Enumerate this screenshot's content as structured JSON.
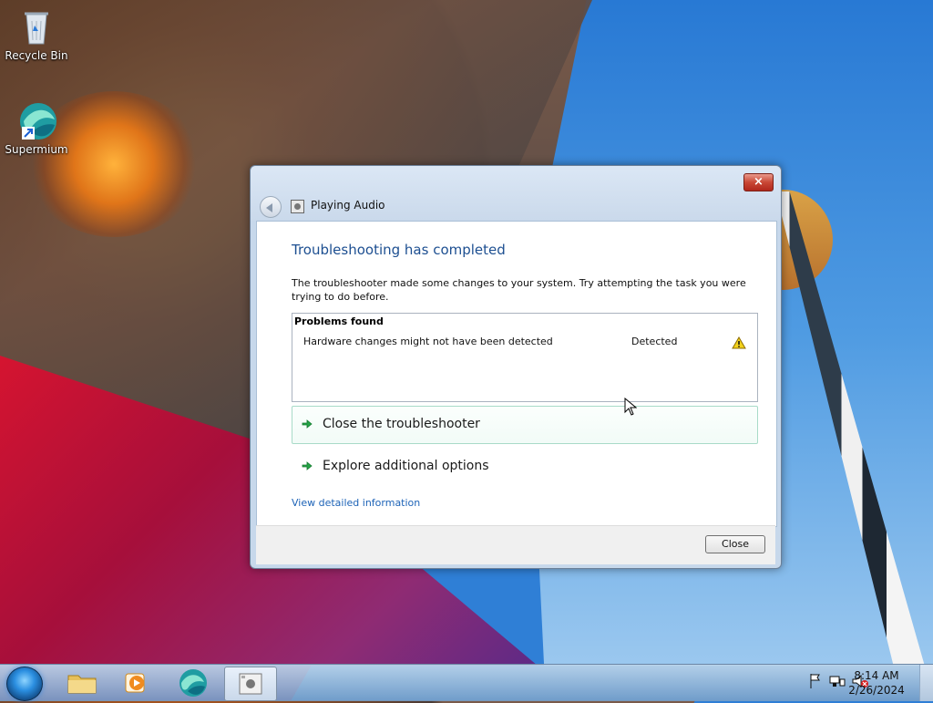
{
  "desktop": {
    "icons": [
      {
        "label": "Recycle Bin",
        "icon": "recycle-bin-icon"
      },
      {
        "label": "Supermium",
        "icon": "supermium-icon"
      }
    ]
  },
  "dialog": {
    "title": "Playing Audio",
    "headline": "Troubleshooting has completed",
    "description": "The troubleshooter made some changes to your system. Try attempting the task you were trying to do before.",
    "problems_header": "Problems found",
    "problems": [
      {
        "text": "Hardware changes might not have been detected",
        "status": "Detected",
        "icon": "warning-icon"
      }
    ],
    "actions": [
      {
        "label": "Close the troubleshooter",
        "icon": "green-arrow-icon"
      },
      {
        "label": "Explore additional options",
        "icon": "green-arrow-icon"
      }
    ],
    "detail_link": "View detailed information",
    "close_button": "Close",
    "close_icon": "close-icon"
  },
  "taskbar": {
    "items": [
      "start-orb-icon",
      "file-explorer-icon",
      "media-player-icon",
      "supermium-icon",
      "troubleshooter-icon"
    ],
    "clock_time": "8:14 AM",
    "clock_date": "2/26/2024"
  }
}
